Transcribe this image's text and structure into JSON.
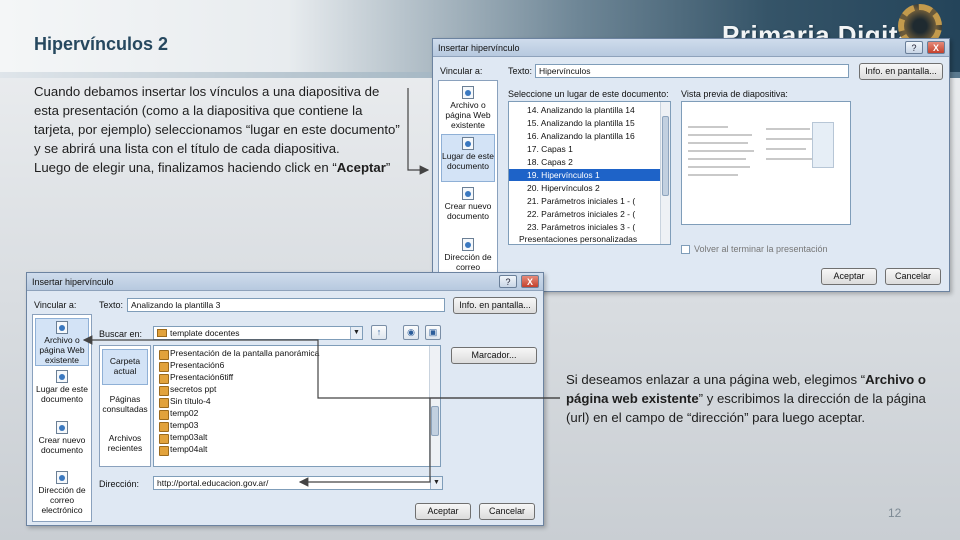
{
  "slide": {
    "title": "Hipervínculos 2",
    "logo_text": "Primaria Digital",
    "paragraph1": "Cuando debamos insertar los vínculos a una diapositiva de esta presentación (como a la diapositiva que contiene la tarjeta, por ejemplo) seleccionamos “lugar en este documento” y se abrirá una lista con el título de cada diapositiva.",
    "paragraph1b_prefix": "Luego de elegir una, finalizamos haciendo click en “",
    "paragraph1b_bold": "Aceptar",
    "paragraph1b_suffix": "”",
    "paragraph2_prefix": "Si deseamos enlazar a una página web, elegimos “",
    "paragraph2_bold": "Archivo o página web existente",
    "paragraph2_suffix": "” y escribimos la dirección de la página (url) en el campo de “dirección” para luego aceptar.",
    "page_number": "12"
  },
  "dialog1": {
    "title": "Insertar hipervínculo",
    "help": "?",
    "close": "X",
    "link_to_label": "Vincular a:",
    "text_label": "Texto:",
    "text_value": "Hipervínculos",
    "screen_tip_button": "Info. en pantalla...",
    "select_place_label": "Seleccione un lugar de este documento:",
    "preview_label": "Vista previa de diapositiva:",
    "nav": [
      {
        "label": "Archivo o página Web existente"
      },
      {
        "label": "Lugar de este documento"
      },
      {
        "label": "Crear nuevo documento"
      },
      {
        "label": "Dirección de correo"
      }
    ],
    "places": [
      "14. Analizando la plantilla 14",
      "15. Analizando la plantilla 15",
      "16. Analizando la plantilla 16",
      "17. Capas 1",
      "18. Capas 2",
      "19. Hipervínculos 1",
      "20. Hipervínculos 2",
      "21. Parámetros iniciales 1 - (",
      "22. Parámetros iniciales 2 - (",
      "23. Parámetros iniciales 3 - (",
      "Presentaciones personalizadas"
    ],
    "selected_place_index": 5,
    "return_checkbox_label": "Volver al terminar la presentación",
    "ok_button": "Aceptar",
    "cancel_button": "Cancelar"
  },
  "dialog2": {
    "title": "Insertar hipervínculo",
    "help": "?",
    "close": "X",
    "link_to_label": "Vincular a:",
    "text_label": "Texto:",
    "text_value": "Analizando la plantilla 3",
    "screen_tip_button": "Info. en pantalla...",
    "look_in_label": "Buscar en:",
    "look_in_value": "template docentes",
    "bookmark_button": "Marcador...",
    "address_label": "Dirección:",
    "address_value": "http://portal.educacion.gov.ar/",
    "nav": [
      {
        "label": "Archivo o página Web existente"
      },
      {
        "label": "Lugar de este documento"
      },
      {
        "label": "Crear nuevo documento"
      },
      {
        "label": "Dirección de correo electrónico"
      }
    ],
    "sources": [
      {
        "label": "Carpeta actual"
      },
      {
        "label": "Páginas consultadas"
      },
      {
        "label": "Archivos recientes"
      }
    ],
    "files": [
      "Presentación de la pantalla panorámica",
      "Presentación6",
      "Presentación6tiff",
      "secretos ppt",
      "Sin título-4",
      "temp02",
      "temp03",
      "temp03alt",
      "temp04alt"
    ],
    "ok_button": "Aceptar",
    "cancel_button": "Cancelar"
  },
  "colors": {
    "title": "#26485f",
    "selection": "#1e63c8",
    "dialog_bg": "#dfe8f3"
  }
}
